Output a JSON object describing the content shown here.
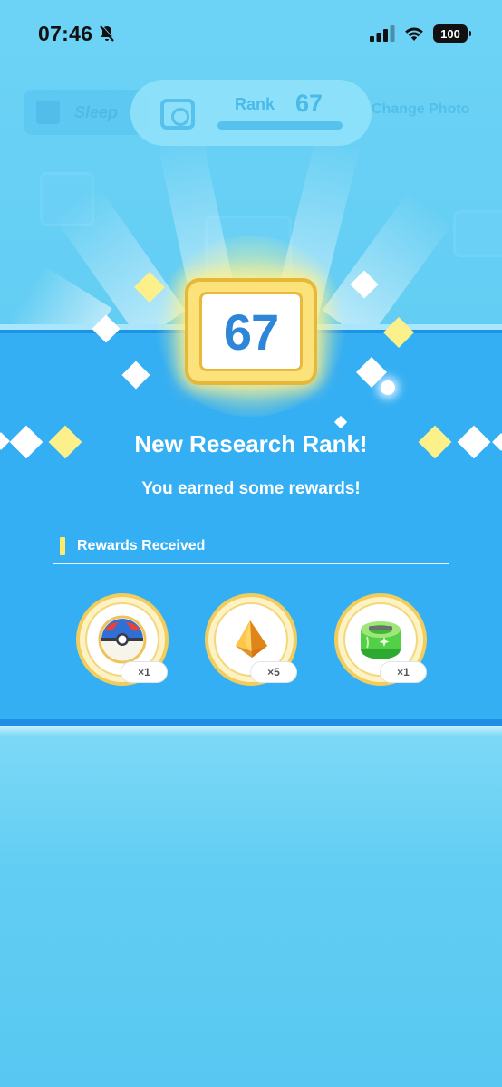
{
  "status_bar": {
    "time": "07:46",
    "battery": "100",
    "icons": [
      "bell-muted-icon",
      "cellular-signal-icon",
      "wifi-icon",
      "battery-icon"
    ]
  },
  "background_header": {
    "tab_label": "Sleep",
    "change_photo_label": "Change Photo",
    "rank_label": "Rank",
    "rank_value": "67"
  },
  "rank_badge": {
    "value": "67"
  },
  "headline": {
    "title": "New Research Rank!",
    "subtitle": "You earned some rewards!"
  },
  "rewards": {
    "section_title": "Rewards Received",
    "items": [
      {
        "icon": "great-ball-icon",
        "quantity": "×1"
      },
      {
        "icon": "crystal-shard-icon",
        "quantity": "×5"
      },
      {
        "icon": "green-incense-icon",
        "quantity": "×1"
      }
    ]
  },
  "colors": {
    "panel_blue": "#35aff3",
    "background_sky": "#5cccf3",
    "badge_gold": "#fbe27b",
    "number_blue": "#2e86d9",
    "accent_yellow": "#fbed67"
  }
}
